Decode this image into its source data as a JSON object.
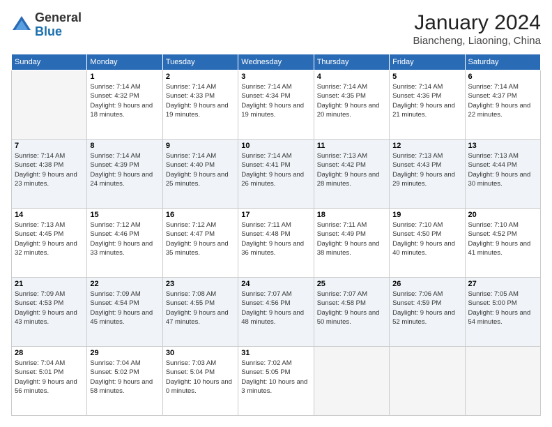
{
  "header": {
    "logo_general": "General",
    "logo_blue": "Blue",
    "month_title": "January 2024",
    "subtitle": "Biancheng, Liaoning, China"
  },
  "days_of_week": [
    "Sunday",
    "Monday",
    "Tuesday",
    "Wednesday",
    "Thursday",
    "Friday",
    "Saturday"
  ],
  "weeks": [
    [
      {
        "day": "",
        "empty": true
      },
      {
        "day": "1",
        "sunrise": "Sunrise: 7:14 AM",
        "sunset": "Sunset: 4:32 PM",
        "daylight": "Daylight: 9 hours and 18 minutes."
      },
      {
        "day": "2",
        "sunrise": "Sunrise: 7:14 AM",
        "sunset": "Sunset: 4:33 PM",
        "daylight": "Daylight: 9 hours and 19 minutes."
      },
      {
        "day": "3",
        "sunrise": "Sunrise: 7:14 AM",
        "sunset": "Sunset: 4:34 PM",
        "daylight": "Daylight: 9 hours and 19 minutes."
      },
      {
        "day": "4",
        "sunrise": "Sunrise: 7:14 AM",
        "sunset": "Sunset: 4:35 PM",
        "daylight": "Daylight: 9 hours and 20 minutes."
      },
      {
        "day": "5",
        "sunrise": "Sunrise: 7:14 AM",
        "sunset": "Sunset: 4:36 PM",
        "daylight": "Daylight: 9 hours and 21 minutes."
      },
      {
        "day": "6",
        "sunrise": "Sunrise: 7:14 AM",
        "sunset": "Sunset: 4:37 PM",
        "daylight": "Daylight: 9 hours and 22 minutes."
      }
    ],
    [
      {
        "day": "7",
        "sunrise": "Sunrise: 7:14 AM",
        "sunset": "Sunset: 4:38 PM",
        "daylight": "Daylight: 9 hours and 23 minutes."
      },
      {
        "day": "8",
        "sunrise": "Sunrise: 7:14 AM",
        "sunset": "Sunset: 4:39 PM",
        "daylight": "Daylight: 9 hours and 24 minutes."
      },
      {
        "day": "9",
        "sunrise": "Sunrise: 7:14 AM",
        "sunset": "Sunset: 4:40 PM",
        "daylight": "Daylight: 9 hours and 25 minutes."
      },
      {
        "day": "10",
        "sunrise": "Sunrise: 7:14 AM",
        "sunset": "Sunset: 4:41 PM",
        "daylight": "Daylight: 9 hours and 26 minutes."
      },
      {
        "day": "11",
        "sunrise": "Sunrise: 7:13 AM",
        "sunset": "Sunset: 4:42 PM",
        "daylight": "Daylight: 9 hours and 28 minutes."
      },
      {
        "day": "12",
        "sunrise": "Sunrise: 7:13 AM",
        "sunset": "Sunset: 4:43 PM",
        "daylight": "Daylight: 9 hours and 29 minutes."
      },
      {
        "day": "13",
        "sunrise": "Sunrise: 7:13 AM",
        "sunset": "Sunset: 4:44 PM",
        "daylight": "Daylight: 9 hours and 30 minutes."
      }
    ],
    [
      {
        "day": "14",
        "sunrise": "Sunrise: 7:13 AM",
        "sunset": "Sunset: 4:45 PM",
        "daylight": "Daylight: 9 hours and 32 minutes."
      },
      {
        "day": "15",
        "sunrise": "Sunrise: 7:12 AM",
        "sunset": "Sunset: 4:46 PM",
        "daylight": "Daylight: 9 hours and 33 minutes."
      },
      {
        "day": "16",
        "sunrise": "Sunrise: 7:12 AM",
        "sunset": "Sunset: 4:47 PM",
        "daylight": "Daylight: 9 hours and 35 minutes."
      },
      {
        "day": "17",
        "sunrise": "Sunrise: 7:11 AM",
        "sunset": "Sunset: 4:48 PM",
        "daylight": "Daylight: 9 hours and 36 minutes."
      },
      {
        "day": "18",
        "sunrise": "Sunrise: 7:11 AM",
        "sunset": "Sunset: 4:49 PM",
        "daylight": "Daylight: 9 hours and 38 minutes."
      },
      {
        "day": "19",
        "sunrise": "Sunrise: 7:10 AM",
        "sunset": "Sunset: 4:50 PM",
        "daylight": "Daylight: 9 hours and 40 minutes."
      },
      {
        "day": "20",
        "sunrise": "Sunrise: 7:10 AM",
        "sunset": "Sunset: 4:52 PM",
        "daylight": "Daylight: 9 hours and 41 minutes."
      }
    ],
    [
      {
        "day": "21",
        "sunrise": "Sunrise: 7:09 AM",
        "sunset": "Sunset: 4:53 PM",
        "daylight": "Daylight: 9 hours and 43 minutes."
      },
      {
        "day": "22",
        "sunrise": "Sunrise: 7:09 AM",
        "sunset": "Sunset: 4:54 PM",
        "daylight": "Daylight: 9 hours and 45 minutes."
      },
      {
        "day": "23",
        "sunrise": "Sunrise: 7:08 AM",
        "sunset": "Sunset: 4:55 PM",
        "daylight": "Daylight: 9 hours and 47 minutes."
      },
      {
        "day": "24",
        "sunrise": "Sunrise: 7:07 AM",
        "sunset": "Sunset: 4:56 PM",
        "daylight": "Daylight: 9 hours and 48 minutes."
      },
      {
        "day": "25",
        "sunrise": "Sunrise: 7:07 AM",
        "sunset": "Sunset: 4:58 PM",
        "daylight": "Daylight: 9 hours and 50 minutes."
      },
      {
        "day": "26",
        "sunrise": "Sunrise: 7:06 AM",
        "sunset": "Sunset: 4:59 PM",
        "daylight": "Daylight: 9 hours and 52 minutes."
      },
      {
        "day": "27",
        "sunrise": "Sunrise: 7:05 AM",
        "sunset": "Sunset: 5:00 PM",
        "daylight": "Daylight: 9 hours and 54 minutes."
      }
    ],
    [
      {
        "day": "28",
        "sunrise": "Sunrise: 7:04 AM",
        "sunset": "Sunset: 5:01 PM",
        "daylight": "Daylight: 9 hours and 56 minutes."
      },
      {
        "day": "29",
        "sunrise": "Sunrise: 7:04 AM",
        "sunset": "Sunset: 5:02 PM",
        "daylight": "Daylight: 9 hours and 58 minutes."
      },
      {
        "day": "30",
        "sunrise": "Sunrise: 7:03 AM",
        "sunset": "Sunset: 5:04 PM",
        "daylight": "Daylight: 10 hours and 0 minutes."
      },
      {
        "day": "31",
        "sunrise": "Sunrise: 7:02 AM",
        "sunset": "Sunset: 5:05 PM",
        "daylight": "Daylight: 10 hours and 3 minutes."
      },
      {
        "day": "",
        "empty": true
      },
      {
        "day": "",
        "empty": true
      },
      {
        "day": "",
        "empty": true
      }
    ]
  ]
}
